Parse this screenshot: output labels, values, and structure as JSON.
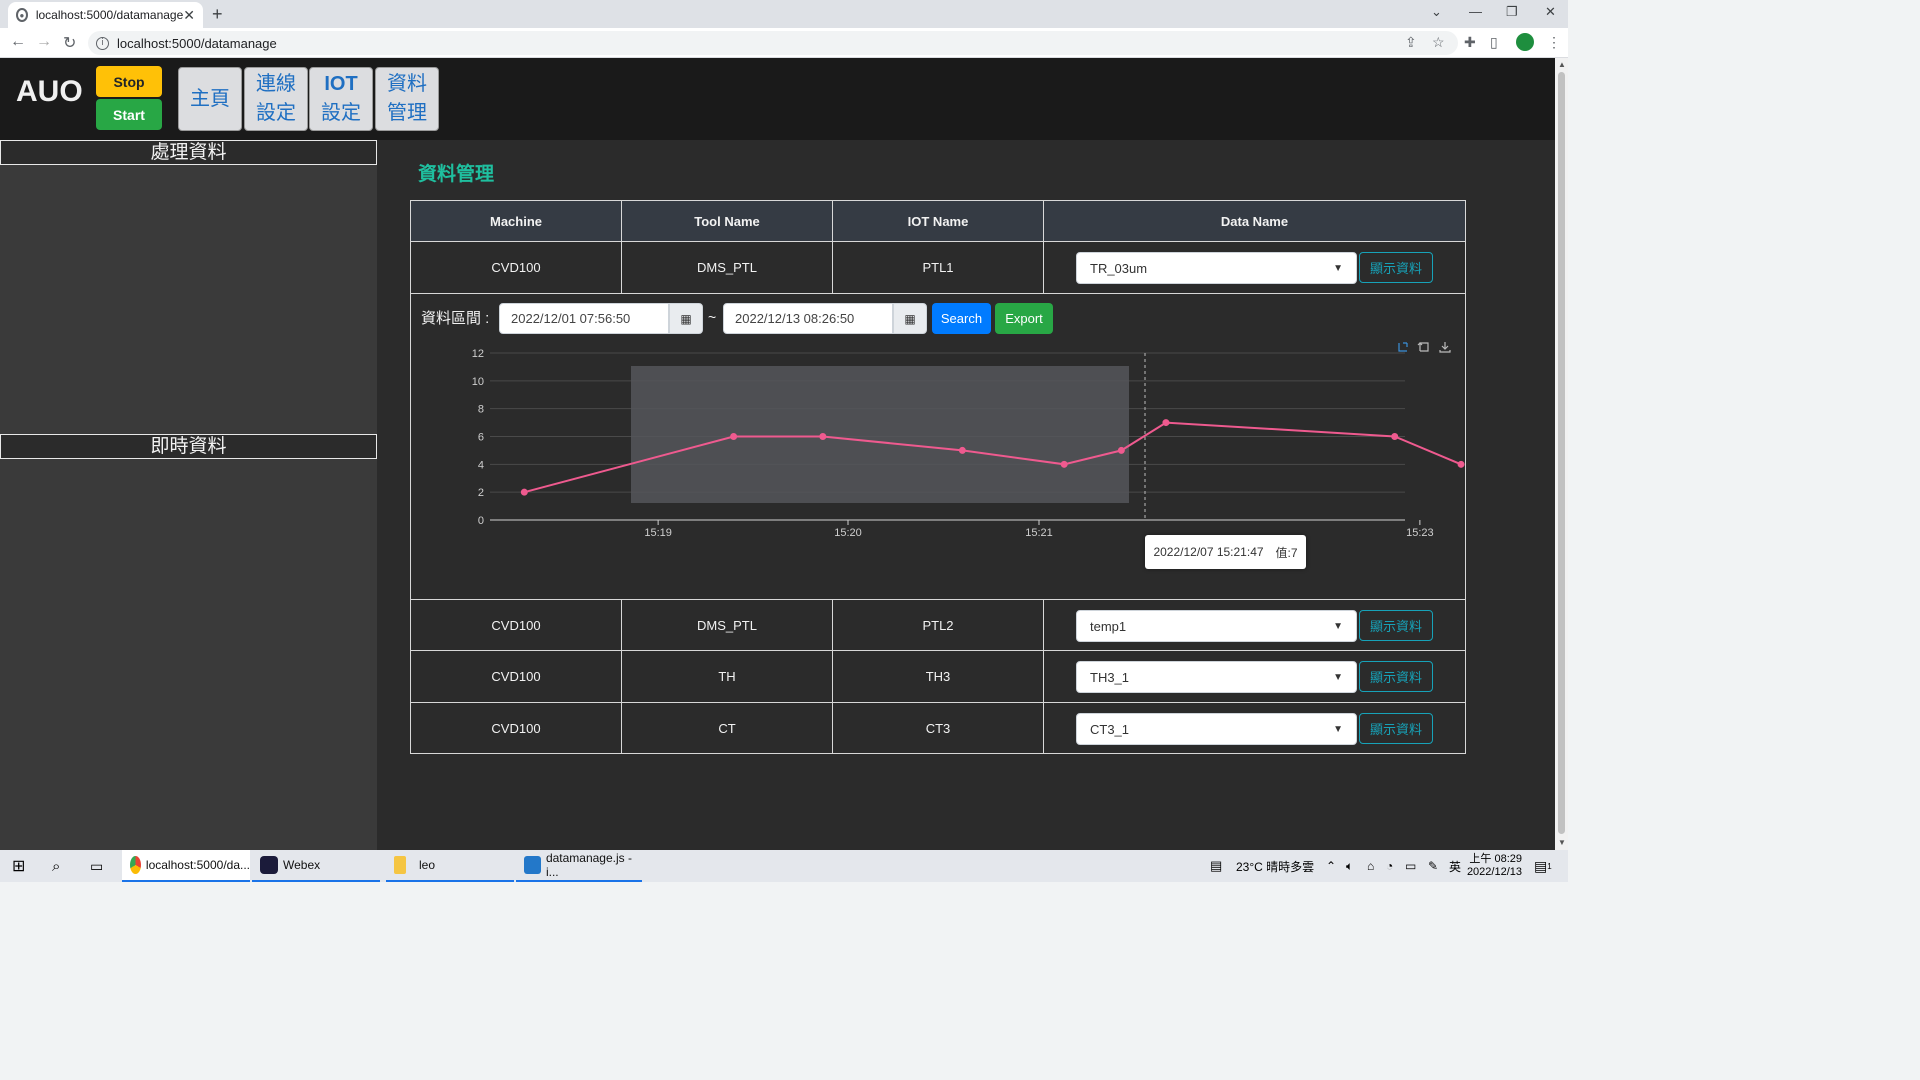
{
  "browser": {
    "tab_title": "localhost:5000/datamanage",
    "url": "localhost:5000/datamanage"
  },
  "header": {
    "brand": "AUO",
    "stop_label": "Stop",
    "start_label": "Start",
    "nav": [
      {
        "line1": "主頁",
        "line2": ""
      },
      {
        "line1": "連線",
        "line2": "設定"
      },
      {
        "line1": "IOT",
        "line2": "設定"
      },
      {
        "line1": "資料",
        "line2": "管理"
      }
    ]
  },
  "sidebar": {
    "section1": "處理資料",
    "section2": "即時資料"
  },
  "main": {
    "title": "資料管理",
    "columns": [
      "Machine",
      "Tool Name",
      "IOT Name",
      "Data Name"
    ],
    "show_label": "顯示資料",
    "rows": [
      {
        "machine": "CVD100",
        "tool": "DMS_PTL",
        "iot": "PTL1",
        "data": "TR_03um"
      },
      {
        "machine": "CVD100",
        "tool": "DMS_PTL",
        "iot": "PTL2",
        "data": "temp1"
      },
      {
        "machine": "CVD100",
        "tool": "TH",
        "iot": "TH3",
        "data": "TH3_1"
      },
      {
        "machine": "CVD100",
        "tool": "CT",
        "iot": "CT3",
        "data": "CT3_1"
      }
    ],
    "range_label": "資料區間 :",
    "start_date": "2022/12/01 07:56:50",
    "end_date": "2022/12/13 08:26:50",
    "tilde": "~",
    "search_label": "Search",
    "export_label": "Export",
    "tooltip": {
      "time": "2022/12/07 15:21:47",
      "value": "值:7"
    }
  },
  "chart_data": {
    "type": "line",
    "title": "",
    "xlabel": "",
    "ylabel": "",
    "x_ticks": [
      "15:19",
      "15:20",
      "15:21",
      "15:23"
    ],
    "y_ticks": [
      0,
      2,
      4,
      6,
      8,
      10,
      12
    ],
    "ylim": [
      0,
      12
    ],
    "xlim_minutes": [
      15.302,
      15.382
    ],
    "series": [
      {
        "name": "",
        "color": "#ef5a8f",
        "x": [
          "15:18:18",
          "15:19:14",
          "15:19:52",
          "15:20:38",
          "15:21:08",
          "15:21:34",
          "15:21:47",
          "15:22:52",
          "15:23:13"
        ],
        "xm": [
          15.305,
          15.3233,
          15.3311,
          15.3433,
          15.3522,
          15.3572,
          15.3611,
          15.3811,
          15.3869
        ],
        "y": [
          2,
          6,
          6,
          5,
          4,
          5,
          7,
          6,
          4
        ]
      }
    ],
    "grid": true,
    "hover_x": "15:21:47"
  },
  "taskbar": {
    "apps": [
      {
        "label": "localhost:5000/da..."
      },
      {
        "label": "Webex"
      },
      {
        "label": "leo"
      },
      {
        "label": "datamanage.js - i..."
      }
    ],
    "weather": "23°C  晴時多雲",
    "ime": "英",
    "time": "上午 08:29",
    "date": "2022/12/13",
    "notif": "1"
  }
}
